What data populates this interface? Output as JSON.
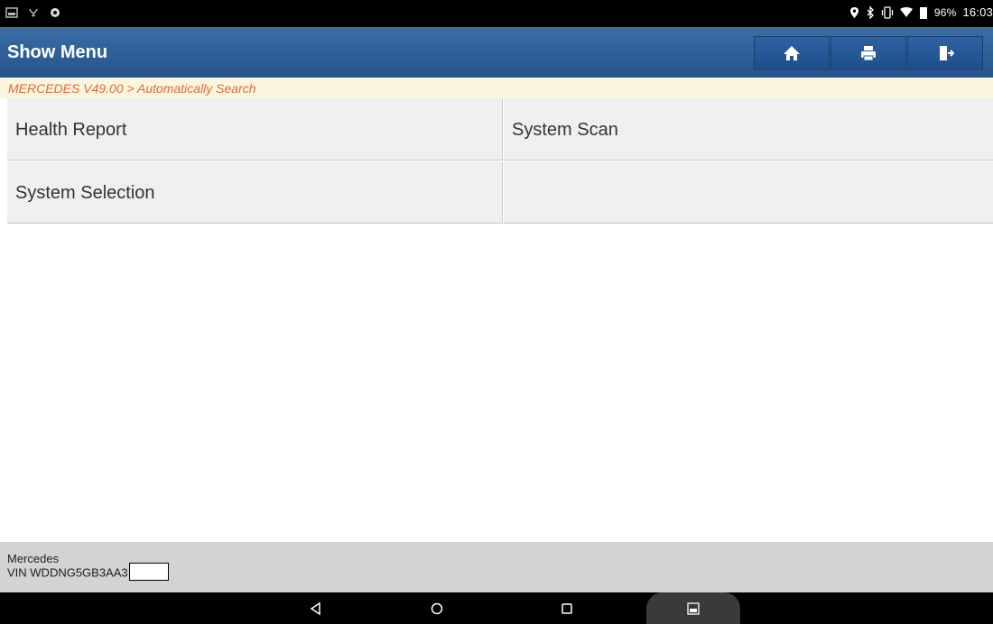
{
  "status_bar": {
    "battery": "96%",
    "time": "16:03",
    "left_icons": [
      "screenshot-icon",
      "usb-debug-icon",
      "diagnostic-icon"
    ],
    "right_icons": [
      "location-icon",
      "bluetooth-icon",
      "vibrate-icon",
      "wifi-icon",
      "battery-icon"
    ]
  },
  "app_bar": {
    "title": "Show Menu",
    "buttons": [
      "home-icon",
      "print-icon",
      "exit-icon"
    ],
    "background": "#2d5f98"
  },
  "breadcrumb": {
    "text": "MERCEDES V49.00 > Automatically Search",
    "color": "#e2663b"
  },
  "menu": {
    "items": [
      "Health Report",
      "System Scan",
      "System Selection",
      ""
    ]
  },
  "footer": {
    "make": "Mercedes",
    "vin": "VIN WDDNG5GB3AA3"
  },
  "nav_bar": {
    "buttons": [
      "back-icon",
      "home-circle-icon",
      "recents-icon",
      "gallery-icon"
    ]
  }
}
